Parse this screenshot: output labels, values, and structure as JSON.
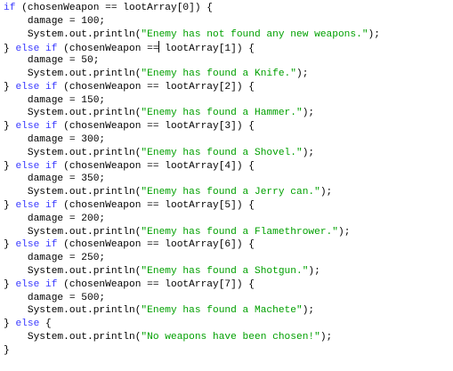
{
  "editor": {
    "colors": {
      "background": "#ffffff",
      "keyword": "#3a3aff",
      "string": "#00a000",
      "plain": "#000000"
    },
    "lines": [
      [
        {
          "t": "if",
          "c": "keyword"
        },
        {
          "t": " (chosenWeapon == lootArray[0]) {",
          "c": "plain"
        }
      ],
      [
        {
          "t": "    damage = 100;",
          "c": "plain"
        }
      ],
      [
        {
          "t": "    System.out.println(",
          "c": "plain"
        },
        {
          "t": "\"Enemy has not found any new weapons.\"",
          "c": "string"
        },
        {
          "t": ");",
          "c": "plain"
        }
      ],
      [
        {
          "t": "} ",
          "c": "plain"
        },
        {
          "t": "else if",
          "c": "keyword"
        },
        {
          "t": " (chosenWeapon ==",
          "c": "plain"
        },
        {
          "caret": true
        },
        {
          "t": " lootArray[1]) {",
          "c": "plain"
        }
      ],
      [
        {
          "t": "    damage = 50;",
          "c": "plain"
        }
      ],
      [
        {
          "t": "    System.out.println(",
          "c": "plain"
        },
        {
          "t": "\"Enemy has found a Knife.\"",
          "c": "string"
        },
        {
          "t": ");",
          "c": "plain"
        }
      ],
      [
        {
          "t": "} ",
          "c": "plain"
        },
        {
          "t": "else if",
          "c": "keyword"
        },
        {
          "t": " (chosenWeapon == lootArray[2]) {",
          "c": "plain"
        }
      ],
      [
        {
          "t": "    damage = 150;",
          "c": "plain"
        }
      ],
      [
        {
          "t": "    System.out.println(",
          "c": "plain"
        },
        {
          "t": "\"Enemy has found a Hammer.\"",
          "c": "string"
        },
        {
          "t": ");",
          "c": "plain"
        }
      ],
      [
        {
          "t": "} ",
          "c": "plain"
        },
        {
          "t": "else if",
          "c": "keyword"
        },
        {
          "t": " (chosenWeapon == lootArray[3]) {",
          "c": "plain"
        }
      ],
      [
        {
          "t": "    damage = 300;",
          "c": "plain"
        }
      ],
      [
        {
          "t": "    System.out.println(",
          "c": "plain"
        },
        {
          "t": "\"Enemy has found a Shovel.\"",
          "c": "string"
        },
        {
          "t": ");",
          "c": "plain"
        }
      ],
      [
        {
          "t": "} ",
          "c": "plain"
        },
        {
          "t": "else if",
          "c": "keyword"
        },
        {
          "t": " (chosenWeapon == lootArray[4]) {",
          "c": "plain"
        }
      ],
      [
        {
          "t": "    damage = 350;",
          "c": "plain"
        }
      ],
      [
        {
          "t": "    System.out.println(",
          "c": "plain"
        },
        {
          "t": "\"Enemy has found a Jerry can.\"",
          "c": "string"
        },
        {
          "t": ");",
          "c": "plain"
        }
      ],
      [
        {
          "t": "} ",
          "c": "plain"
        },
        {
          "t": "else if",
          "c": "keyword"
        },
        {
          "t": " (chosenWeapon == lootArray[5]) {",
          "c": "plain"
        }
      ],
      [
        {
          "t": "    damage = 200;",
          "c": "plain"
        }
      ],
      [
        {
          "t": "    System.out.println(",
          "c": "plain"
        },
        {
          "t": "\"Enemy has found a Flamethrower.\"",
          "c": "string"
        },
        {
          "t": ");",
          "c": "plain"
        }
      ],
      [
        {
          "t": "} ",
          "c": "plain"
        },
        {
          "t": "else if",
          "c": "keyword"
        },
        {
          "t": " (chosenWeapon == lootArray[6]) {",
          "c": "plain"
        }
      ],
      [
        {
          "t": "    damage = 250;",
          "c": "plain"
        }
      ],
      [
        {
          "t": "    System.out.println(",
          "c": "plain"
        },
        {
          "t": "\"Enemy has found a Shotgun.\"",
          "c": "string"
        },
        {
          "t": ");",
          "c": "plain"
        }
      ],
      [
        {
          "t": "} ",
          "c": "plain"
        },
        {
          "t": "else if",
          "c": "keyword"
        },
        {
          "t": " (chosenWeapon == lootArray[7]) {",
          "c": "plain"
        }
      ],
      [
        {
          "t": "    damage = 500;",
          "c": "plain"
        }
      ],
      [
        {
          "t": "    System.out.println(",
          "c": "plain"
        },
        {
          "t": "\"Enemy has found a Machete\"",
          "c": "string"
        },
        {
          "t": ");",
          "c": "plain"
        }
      ],
      [
        {
          "t": "} ",
          "c": "plain"
        },
        {
          "t": "else",
          "c": "keyword"
        },
        {
          "t": " {",
          "c": "plain"
        }
      ],
      [
        {
          "t": "    System.out.println(",
          "c": "plain"
        },
        {
          "t": "\"No weapons have been chosen!\"",
          "c": "string"
        },
        {
          "t": ");",
          "c": "plain"
        }
      ],
      [
        {
          "t": "}",
          "c": "plain"
        }
      ]
    ]
  }
}
